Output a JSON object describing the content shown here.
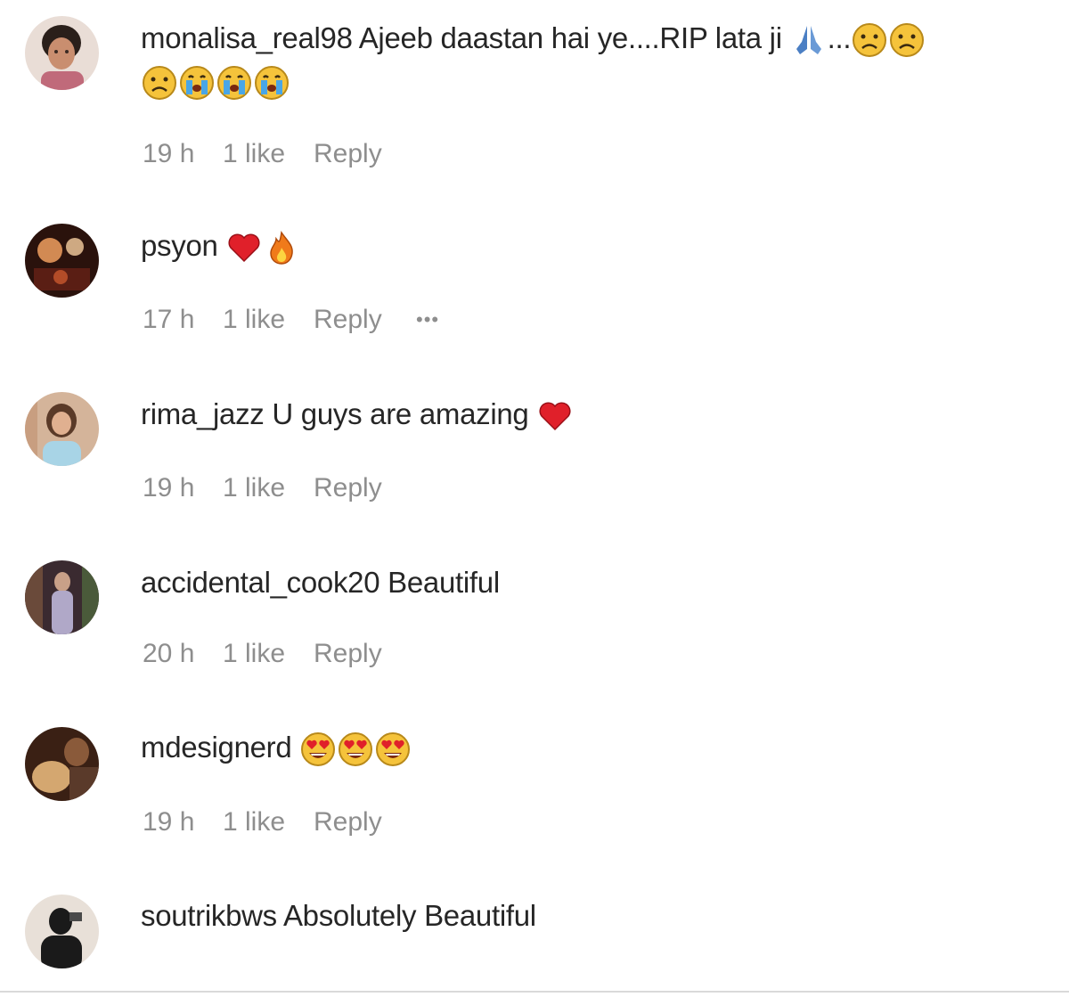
{
  "comments": [
    {
      "username": "monalisa_real98",
      "text": "Ajeeb daastan hai ye....RIP lata ji",
      "emojis_line1": [
        "folded-hands",
        "sad",
        "sad"
      ],
      "emojis_line2": [
        "sad",
        "crying",
        "crying",
        "crying"
      ],
      "time": "19 h",
      "likes": "1 like",
      "reply": "Reply"
    },
    {
      "username": "psyon",
      "text": "",
      "emojis": [
        "red-heart",
        "fire"
      ],
      "time": "17 h",
      "likes": "1 like",
      "reply": "Reply",
      "more": "•••"
    },
    {
      "username": "rima_jazz",
      "text": "U guys are amazing",
      "emojis": [
        "red-heart"
      ],
      "time": "19 h",
      "likes": "1 like",
      "reply": "Reply"
    },
    {
      "username": "accidental_cook20",
      "text": "Beautiful",
      "time": "20 h",
      "likes": "1 like",
      "reply": "Reply"
    },
    {
      "username": "mdesignerd",
      "text": "",
      "emojis": [
        "heart-eyes",
        "heart-eyes",
        "heart-eyes"
      ],
      "time": "19 h",
      "likes": "1 like",
      "reply": "Reply"
    },
    {
      "username": "soutrikbws",
      "text": "Absolutely Beautiful"
    }
  ],
  "colors": {
    "text": "#262626",
    "meta": "#8e8e8e",
    "divider": "#d9d9d9"
  }
}
